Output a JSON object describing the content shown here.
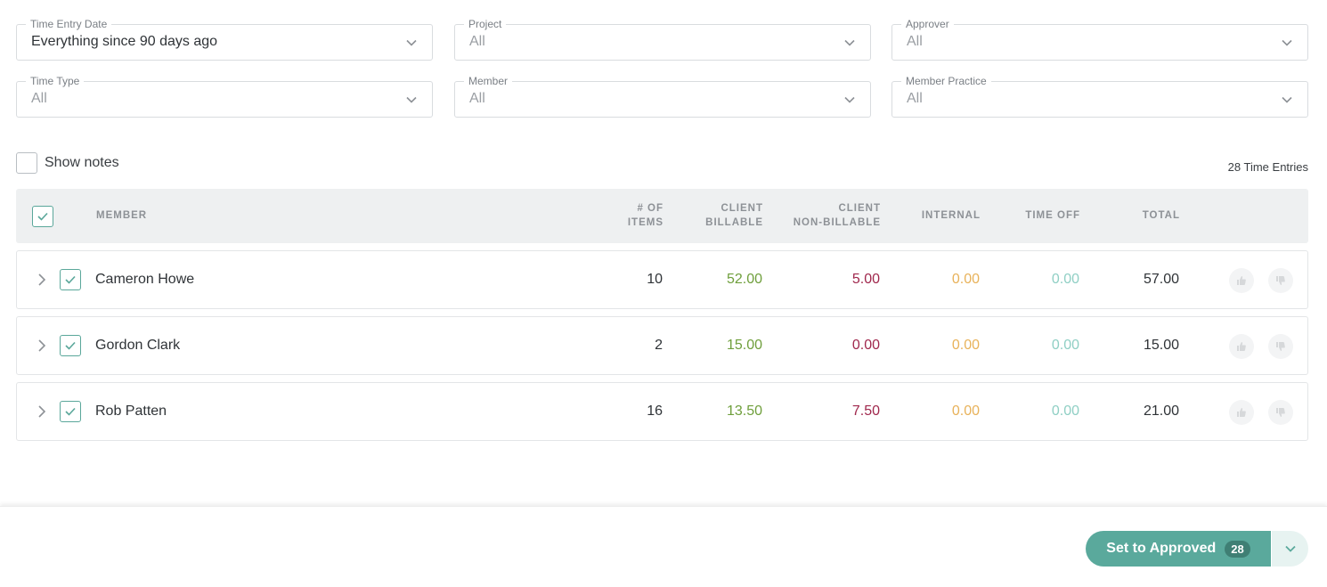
{
  "filters": [
    {
      "label": "Time Entry Date",
      "value": "Everything since 90 days ago",
      "dark": true
    },
    {
      "label": "Project",
      "value": "All",
      "dark": false
    },
    {
      "label": "Approver",
      "value": "All",
      "dark": false
    },
    {
      "label": "Time Type",
      "value": "All",
      "dark": false
    },
    {
      "label": "Member",
      "value": "All",
      "dark": false
    },
    {
      "label": "Member Practice",
      "value": "All",
      "dark": false
    }
  ],
  "show_notes_label": "Show notes",
  "show_notes_checked": false,
  "entries_count": "28 Time Entries",
  "table": {
    "header_checked": true,
    "columns": {
      "member": "MEMBER",
      "items_l1": "# OF",
      "items_l2": "ITEMS",
      "billable_l1": "CLIENT",
      "billable_l2": "BILLABLE",
      "nonbillable_l1": "CLIENT",
      "nonbillable_l2": "NON-BILLABLE",
      "internal": "INTERNAL",
      "timeoff": "TIME OFF",
      "total": "TOTAL"
    },
    "rows": [
      {
        "name": "Cameron Howe",
        "items": "10",
        "billable": "52.00",
        "nonbillable": "5.00",
        "internal": "0.00",
        "timeoff": "0.00",
        "total": "57.00",
        "checked": true
      },
      {
        "name": "Gordon Clark",
        "items": "2",
        "billable": "15.00",
        "nonbillable": "0.00",
        "internal": "0.00",
        "timeoff": "0.00",
        "total": "15.00",
        "checked": true
      },
      {
        "name": "Rob Patten",
        "items": "16",
        "billable": "13.50",
        "nonbillable": "7.50",
        "internal": "0.00",
        "timeoff": "0.00",
        "total": "21.00",
        "checked": true
      }
    ]
  },
  "footer": {
    "approve_label": "Set to Approved",
    "approve_count": "28"
  },
  "colors": {
    "accent": "#5aa99c",
    "billable": "#6f9f3c",
    "nonbillable": "#a0284d",
    "internal": "#e8b25a",
    "timeoff": "#8fcfc4"
  },
  "icons": {
    "chevron": "chevron-down-icon",
    "expand": "chevron-right-icon",
    "check": "check-icon",
    "approve": "thumbs-up-icon",
    "reject": "thumbs-down-icon"
  }
}
